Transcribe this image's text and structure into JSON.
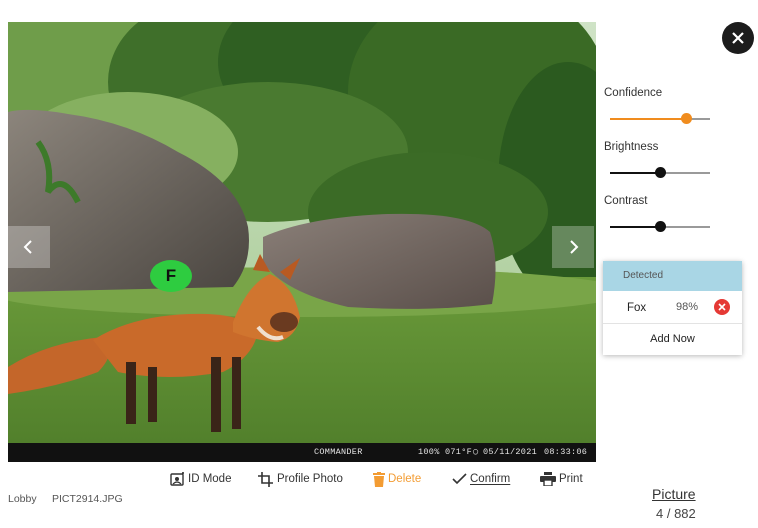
{
  "photo": {
    "id_badge": "F",
    "camera": "COMMANDER",
    "battery": "100%",
    "temperature": "071°F",
    "date": "05/11/2021",
    "time": "08:33:06"
  },
  "sliders": [
    {
      "label": "Confidence",
      "value": 0.76,
      "color": "#f08c1e"
    },
    {
      "label": "Brightness",
      "value": 0.5,
      "color": "#111111"
    },
    {
      "label": "Contrast",
      "value": 0.5,
      "color": "#111111"
    }
  ],
  "detected": {
    "header": "Detected",
    "items": [
      {
        "name": "Fox",
        "confidence": "98%"
      }
    ],
    "add_label": "Add Now"
  },
  "toolbar": {
    "id_mode": "ID Mode",
    "profile_photo": "Profile Photo",
    "delete": "Delete",
    "confirm": "Confirm",
    "print": "Print"
  },
  "footer": {
    "location": "Lobby",
    "filename": "PICT2914.JPG",
    "picture_label": "Picture",
    "picture_count": "4 / 882"
  },
  "colors": {
    "accent": "#f39c33",
    "detected_header": "#a9d6e5",
    "remove": "#e53935",
    "badge": "#2ecc40"
  }
}
